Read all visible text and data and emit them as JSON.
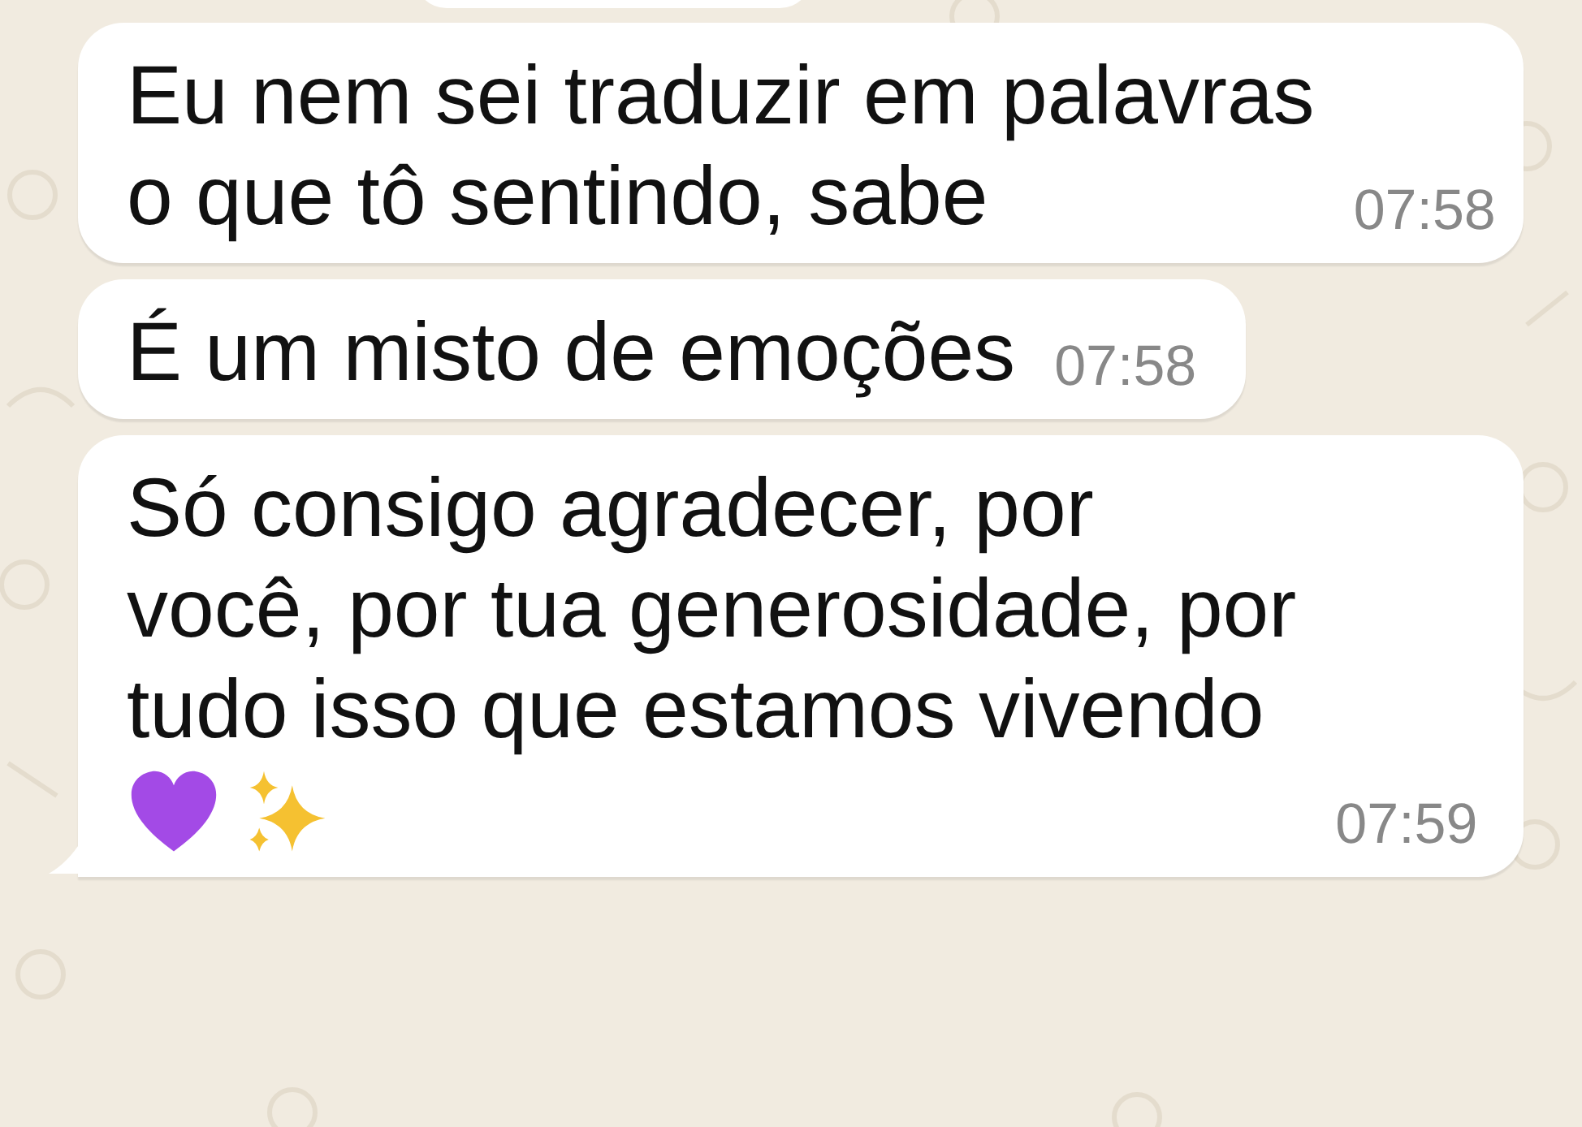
{
  "messages": [
    {
      "text": "Eu nem sei traduzir em palavras\no que tô sentindo, sabe",
      "time": "07:58",
      "tail": false
    },
    {
      "text": "É um misto de emoções",
      "time": "07:58",
      "tail": false
    },
    {
      "text": "Só consigo agradecer, por\nvocê, por tua generosidade, por\ntudo isso que estamos vivendo",
      "emojis": [
        {
          "kind": "heart"
        },
        {
          "kind": "sparkles"
        }
      ],
      "time": "07:59",
      "tail": true
    }
  ]
}
